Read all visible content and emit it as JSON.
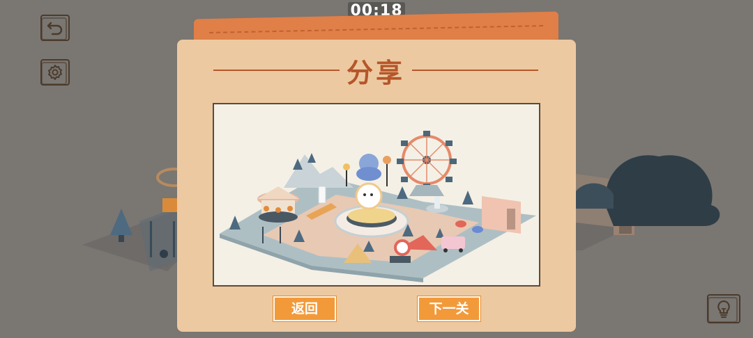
{
  "hud": {
    "timer": "00:18"
  },
  "icons": {
    "back": "undo-arrow-icon",
    "settings": "gear-icon",
    "hint": "lightbulb-icon"
  },
  "dialog": {
    "title": "分享",
    "buttons": {
      "return_label": "返回",
      "next_label": "下一关"
    }
  },
  "colors": {
    "background": "#7a7672",
    "card": "#edc9a1",
    "accent_orange": "#f29a3a",
    "title_brown": "#b5562a"
  }
}
